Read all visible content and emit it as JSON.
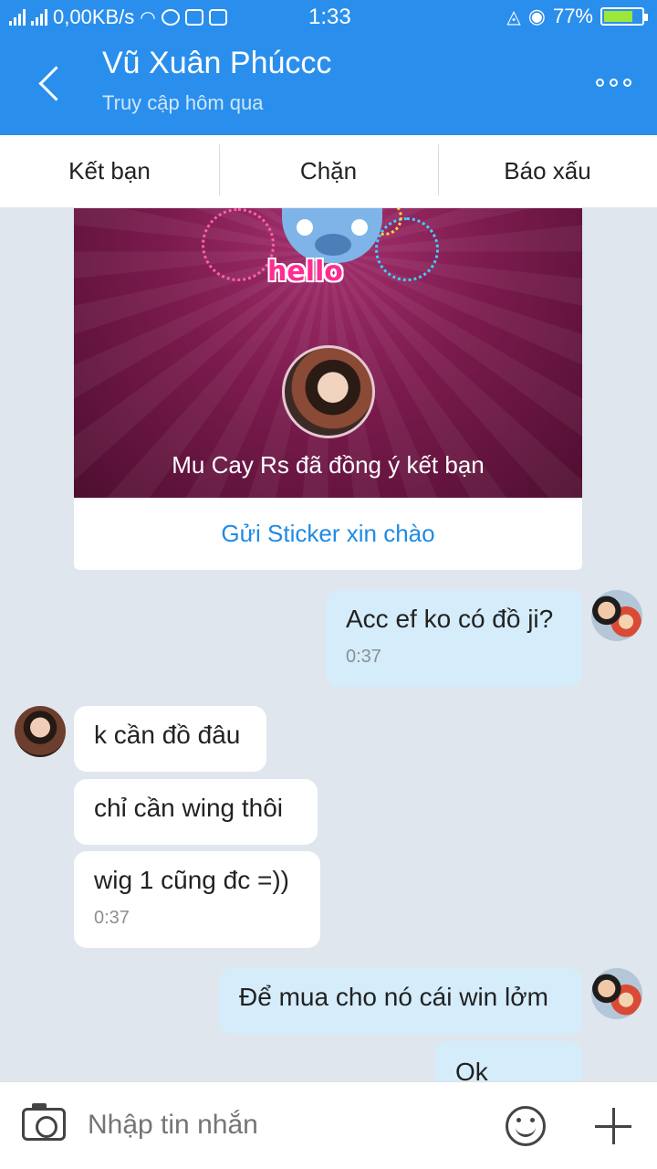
{
  "status_bar": {
    "net_speed": "0,00KB/s",
    "time": "1:33",
    "battery": "77%",
    "battery_level": 0.77
  },
  "header": {
    "title": "Vũ Xuân Phúccc",
    "subtitle": "Truy cập hôm qua"
  },
  "actions": {
    "add_friend": "Kết bạn",
    "block": "Chặn",
    "report": "Báo xấu"
  },
  "friend_card": {
    "sticker_text": "hello",
    "message": "Mu Cay Rs đã đồng ý kết bạn",
    "link": "Gửi Sticker xin chào"
  },
  "messages": [
    {
      "side": "out",
      "text": "Acc ef ko có đồ ji?",
      "time": "0:37"
    },
    {
      "side": "in",
      "text": "k cần đồ đâu"
    },
    {
      "side": "in",
      "text": "chỉ cần wing thôi"
    },
    {
      "side": "in",
      "text": "wig 1 cũng đc =))",
      "time": "0:37"
    },
    {
      "side": "out",
      "text": "Để mua cho nó cái win lởm"
    },
    {
      "side": "out",
      "text": "Ok"
    }
  ],
  "input": {
    "placeholder": "Nhập tin nhắn"
  },
  "colors": {
    "primary": "#2a8fec",
    "link": "#1f8be4",
    "outgoing_bubble": "#d5ecfb",
    "background": "#dfe6ee"
  }
}
